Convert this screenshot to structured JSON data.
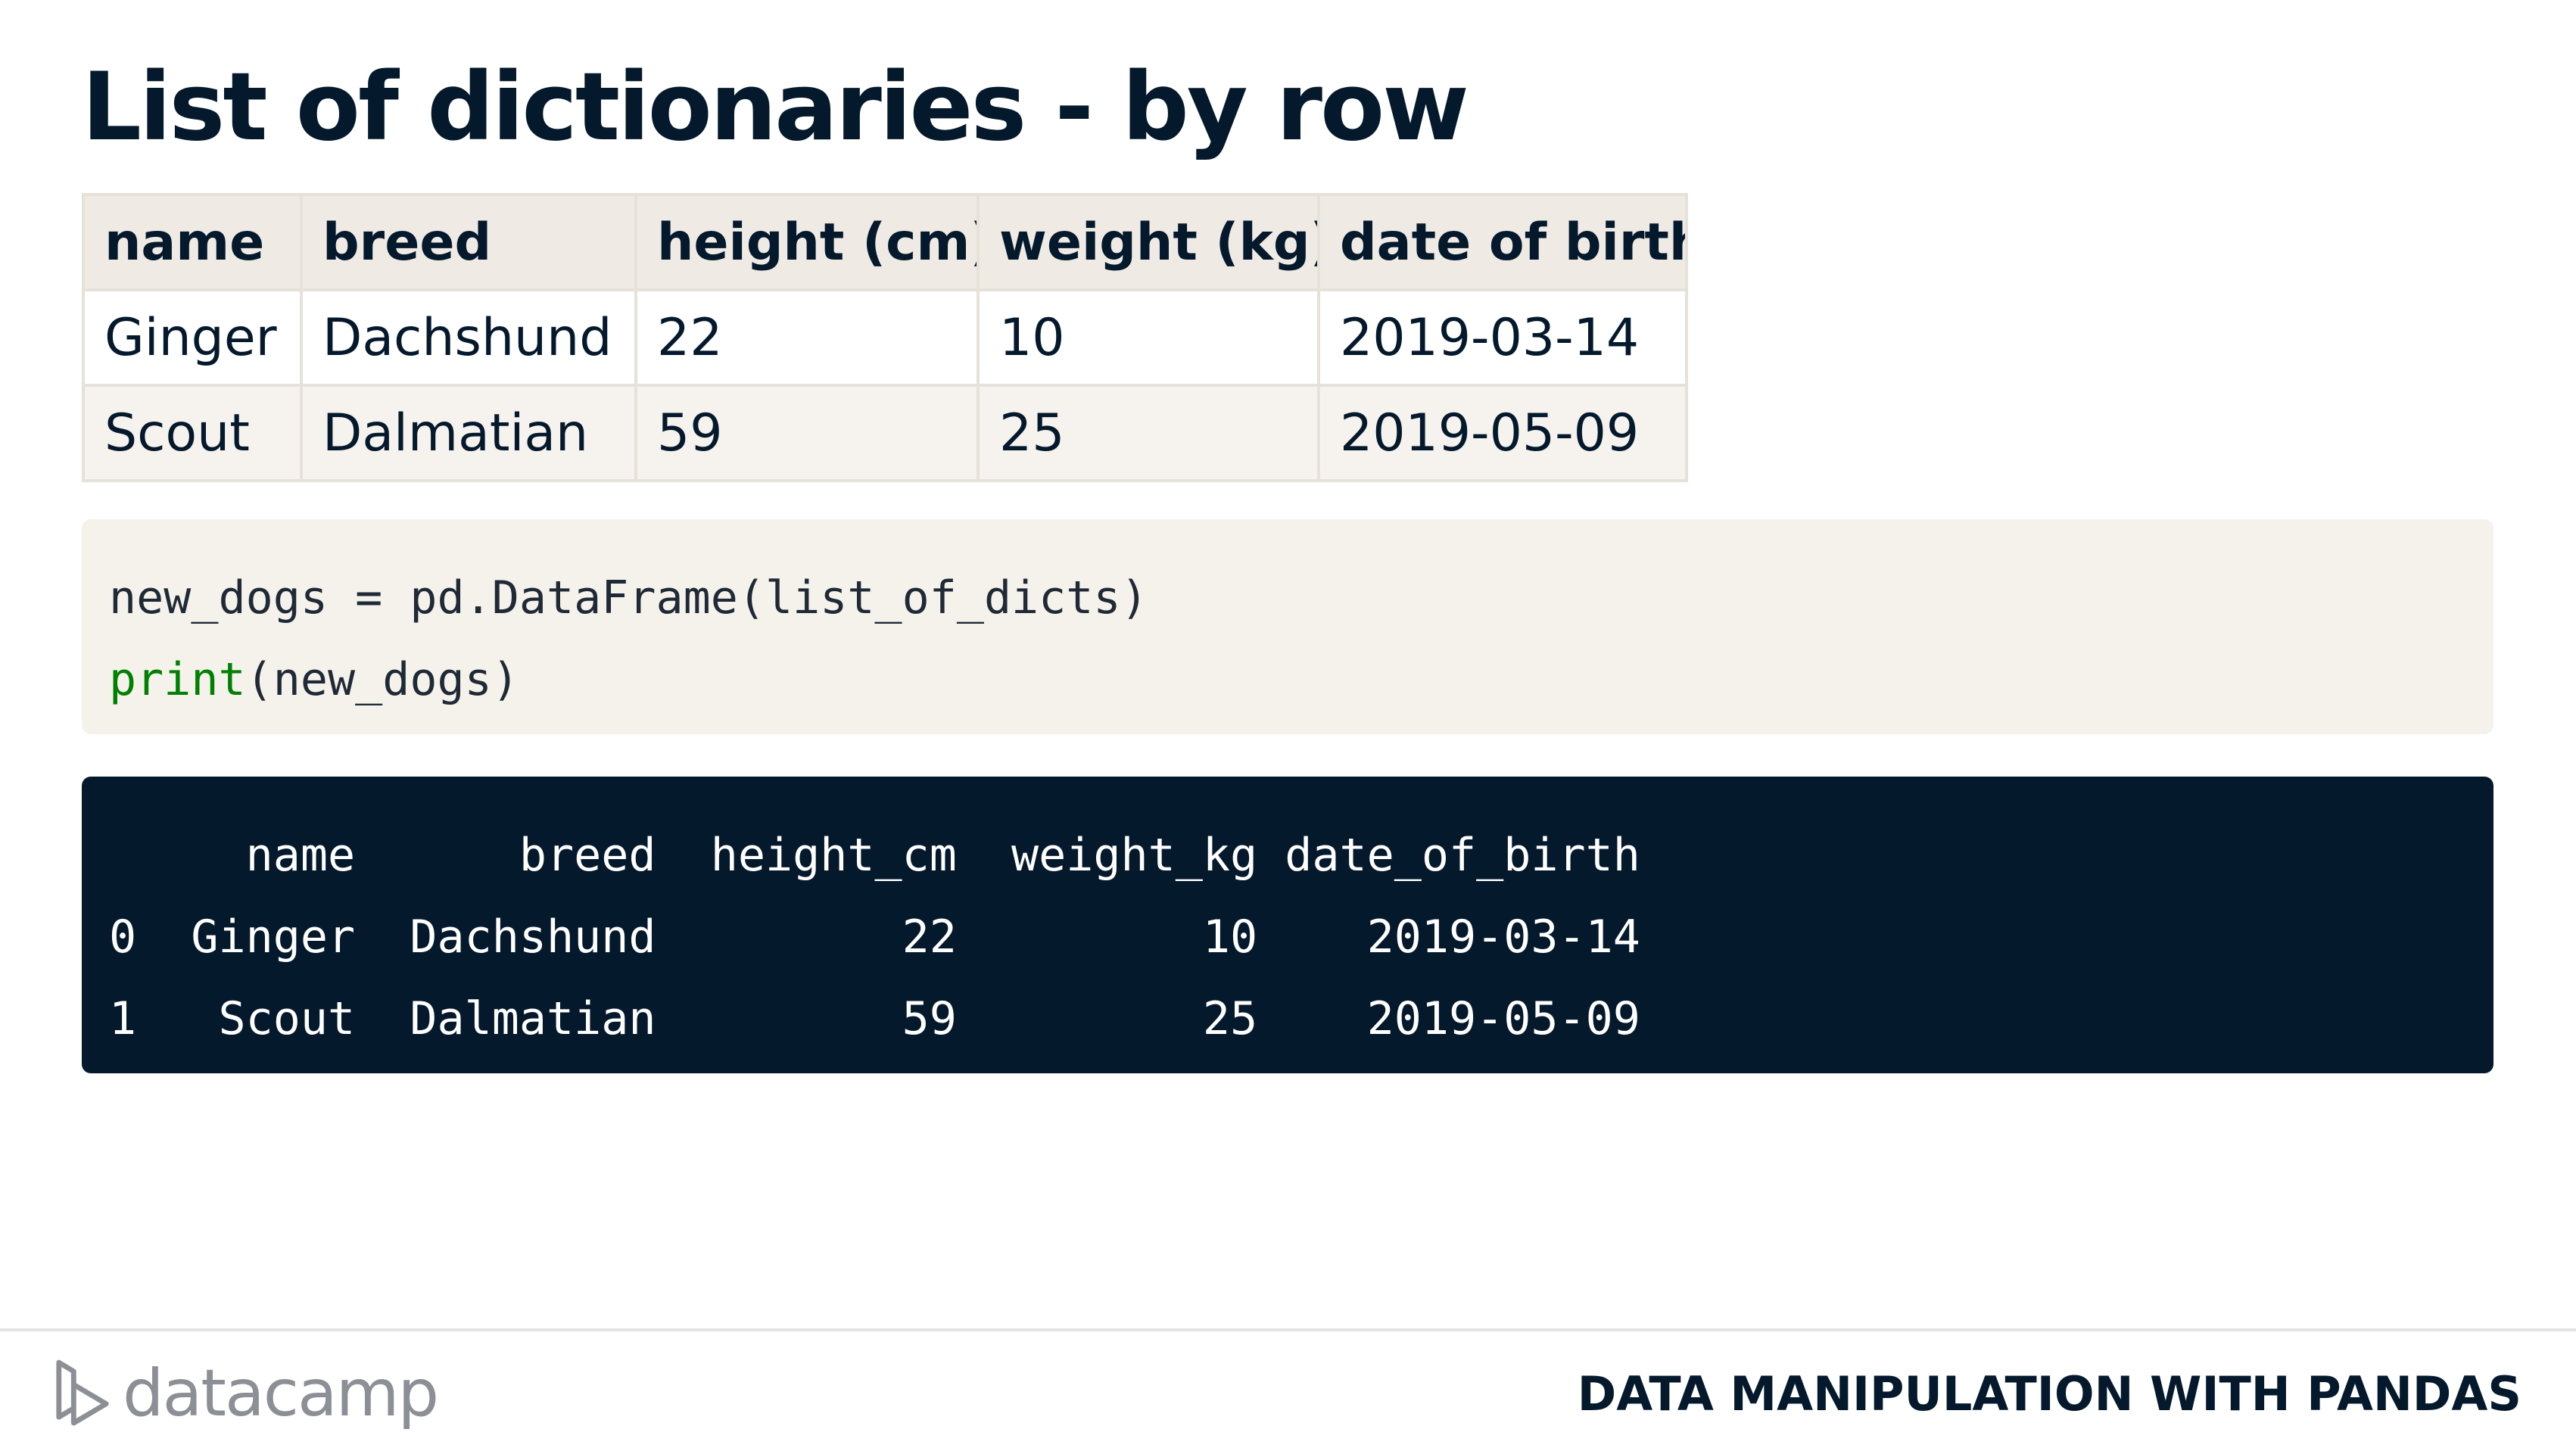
{
  "title": "List of dictionaries - by row",
  "table": {
    "headers": [
      "name",
      "breed",
      "height (cm)",
      "weight (kg)",
      "date of birth"
    ],
    "rows": [
      [
        "Ginger",
        "Dachshund",
        "22",
        "10",
        "2019-03-14"
      ],
      [
        "Scout",
        "Dalmatian",
        "59",
        "25",
        "2019-05-09"
      ]
    ]
  },
  "code": {
    "line1": "new_dogs = pd.DataFrame(list_of_dicts)",
    "line2_keyword": "print",
    "line2_rest": "(new_dogs)"
  },
  "output": {
    "lines": [
      "     name      breed  height_cm  weight_kg date_of_birth",
      "0  Ginger  Dachshund         22         10    2019-03-14",
      "1   Scout  Dalmatian         59         25    2019-05-09"
    ]
  },
  "footer": {
    "brand": "datacamp",
    "course": "DATA MANIPULATION WITH PANDAS"
  },
  "colors": {
    "navy": "#05192d",
    "table_header_bg": "#efebe4",
    "table_border": "#e6e1d9",
    "code_bg": "#f5f2ec",
    "keyword_green": "#008000",
    "brand_gray": "#8c9096"
  }
}
